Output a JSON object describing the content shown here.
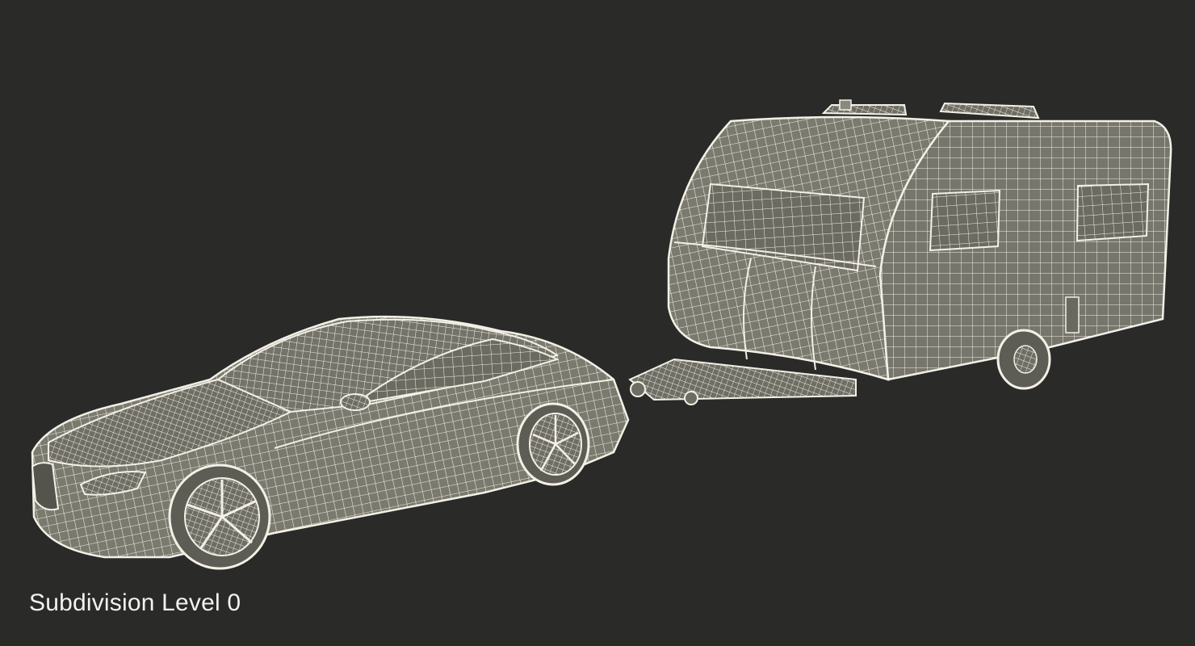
{
  "caption": "Subdivision Level 0",
  "colors": {
    "background": "#2a2a29",
    "mesh_fill": "#7b7a6f",
    "mesh_fill_dark": "#5f5e55",
    "wire": "#f3f0e6",
    "caption_text": "#f2f2f2"
  },
  "objects": [
    "sedan-car",
    "caravan-trailer"
  ]
}
